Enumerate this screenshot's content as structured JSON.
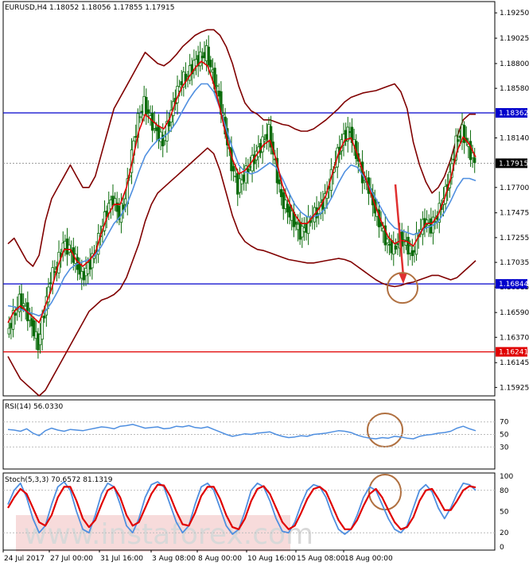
{
  "header": {
    "main": "EURUSD,H4  1.18052 1.18056 1.17855 1.17915",
    "rsi": "RSI(14) 56.0330",
    "stoch": "Stoch(5,3,3) 70.6572 81.1319"
  },
  "watermark": {
    "text": "www.instaforex.com"
  },
  "colors": {
    "candles": "#0a6b0a",
    "bollinger": "#800000",
    "ma_fast": "#e00000",
    "ma_slow": "#4f8fe0",
    "resistance": "#0000cc",
    "support_low": "#e00000",
    "arrow": "#e03030",
    "circle": "#b07040",
    "rsi_line": "#4f8fe0",
    "stoch_k": "#4f8fe0",
    "stoch_d": "#e00000"
  },
  "chart_data": [
    {
      "type": "candlestick",
      "symbol": "EURUSD",
      "timeframe": "H4",
      "ohlc_last": {
        "open": 1.18052,
        "high": 1.18056,
        "low": 1.17855,
        "close": 1.17915
      },
      "ylim": [
        1.1585,
        1.1935
      ],
      "y_ticks": [
        "1.19250",
        "1.19025",
        "1.18800",
        "1.18580",
        "1.18140",
        "1.17700",
        "1.17475",
        "1.17255",
        "1.17035",
        "1.16815",
        "1.16590",
        "1.16370",
        "1.16145",
        "1.15925"
      ],
      "x_ticks": [
        "24 Jul 2017",
        "27 Jul 00:00",
        "31 Jul 16:00",
        "3 Aug 08:00",
        "8 Aug 00:00",
        "10 Aug 16:00",
        "15 Aug 08:00",
        "18 Aug 00:00"
      ],
      "price_labels": [
        {
          "value": 1.18362,
          "label": "1.18362",
          "color": "#0000cc"
        },
        {
          "value": 1.17915,
          "label": "1.17915",
          "color": "#000000"
        },
        {
          "value": 1.16844,
          "label": "1.16844",
          "color": "#0000cc"
        },
        {
          "value": 1.16241,
          "label": "1.16241",
          "color": "#e00000"
        }
      ],
      "horizontal_lines": [
        {
          "value": 1.18362,
          "color": "#0000cc"
        },
        {
          "value": 1.16844,
          "color": "#0000cc"
        },
        {
          "value": 1.16241,
          "color": "#e00000"
        }
      ],
      "close_path": [
        1.164,
        1.1655,
        1.167,
        1.1662,
        1.1648,
        1.163,
        1.166,
        1.169,
        1.17,
        1.172,
        1.1715,
        1.1705,
        1.169,
        1.17,
        1.171,
        1.173,
        1.175,
        1.176,
        1.1745,
        1.176,
        1.18,
        1.183,
        1.1845,
        1.183,
        1.182,
        1.181,
        1.183,
        1.185,
        1.1865,
        1.187,
        1.188,
        1.1885,
        1.189,
        1.187,
        1.185,
        1.182,
        1.179,
        1.177,
        1.178,
        1.179,
        1.18,
        1.181,
        1.182,
        1.179,
        1.176,
        1.175,
        1.174,
        1.173,
        1.1735,
        1.1745,
        1.175,
        1.176,
        1.178,
        1.18,
        1.1815,
        1.182,
        1.18,
        1.178,
        1.177,
        1.175,
        1.1735,
        1.172,
        1.1715,
        1.1725,
        1.172,
        1.171,
        1.173,
        1.174,
        1.1735,
        1.1745,
        1.176,
        1.178,
        1.181,
        1.182,
        1.1805,
        1.1792
      ],
      "ma_fast": [
        1.165,
        1.166,
        1.1665,
        1.166,
        1.1655,
        1.165,
        1.1665,
        1.168,
        1.17,
        1.1715,
        1.1715,
        1.1705,
        1.17,
        1.1705,
        1.1712,
        1.173,
        1.1745,
        1.1755,
        1.1755,
        1.177,
        1.1795,
        1.182,
        1.1835,
        1.183,
        1.1825,
        1.1822,
        1.1832,
        1.1848,
        1.186,
        1.1868,
        1.1876,
        1.1882,
        1.1878,
        1.1862,
        1.184,
        1.1815,
        1.1795,
        1.1782,
        1.1785,
        1.1792,
        1.18,
        1.1808,
        1.1812,
        1.1795,
        1.1772,
        1.1758,
        1.1746,
        1.1738,
        1.1738,
        1.1745,
        1.1752,
        1.1763,
        1.1782,
        1.18,
        1.1812,
        1.1814,
        1.18,
        1.1783,
        1.1768,
        1.1752,
        1.1738,
        1.1726,
        1.172,
        1.1723,
        1.1722,
        1.1718,
        1.1728,
        1.1738,
        1.1738,
        1.1746,
        1.176,
        1.1778,
        1.1802,
        1.1815,
        1.1808,
        1.1797
      ],
      "ma_slow": [
        1.1665,
        1.1664,
        1.1662,
        1.166,
        1.1658,
        1.1656,
        1.166,
        1.1668,
        1.1678,
        1.169,
        1.1698,
        1.1702,
        1.1704,
        1.1706,
        1.171,
        1.1718,
        1.1728,
        1.1738,
        1.1744,
        1.1754,
        1.1768,
        1.1784,
        1.1798,
        1.1806,
        1.1812,
        1.1815,
        1.182,
        1.1828,
        1.1838,
        1.1848,
        1.1856,
        1.1862,
        1.1862,
        1.1855,
        1.184,
        1.1822,
        1.1805,
        1.179,
        1.1784,
        1.1782,
        1.1784,
        1.1788,
        1.1792,
        1.1788,
        1.1778,
        1.1766,
        1.1755,
        1.1748,
        1.1744,
        1.1744,
        1.1746,
        1.1752,
        1.1762,
        1.1774,
        1.1784,
        1.179,
        1.1788,
        1.178,
        1.177,
        1.176,
        1.175,
        1.174,
        1.1734,
        1.1732,
        1.173,
        1.1728,
        1.173,
        1.1734,
        1.1736,
        1.174,
        1.1748,
        1.1758,
        1.177,
        1.1778,
        1.1778,
        1.1776
      ],
      "bb_upper": [
        1.172,
        1.1725,
        1.1715,
        1.1705,
        1.17,
        1.171,
        1.174,
        1.176,
        1.177,
        1.178,
        1.179,
        1.178,
        1.177,
        1.177,
        1.178,
        1.18,
        1.182,
        1.184,
        1.185,
        1.186,
        1.187,
        1.188,
        1.189,
        1.1885,
        1.188,
        1.1878,
        1.1882,
        1.1888,
        1.1895,
        1.19,
        1.1905,
        1.1908,
        1.191,
        1.191,
        1.1905,
        1.1895,
        1.188,
        1.186,
        1.1845,
        1.1838,
        1.1835,
        1.183,
        1.183,
        1.1828,
        1.1826,
        1.1825,
        1.1822,
        1.182,
        1.182,
        1.1822,
        1.1826,
        1.183,
        1.1835,
        1.184,
        1.1846,
        1.185,
        1.1852,
        1.1854,
        1.1855,
        1.1856,
        1.1858,
        1.186,
        1.1862,
        1.1855,
        1.184,
        1.181,
        1.179,
        1.1775,
        1.1765,
        1.177,
        1.178,
        1.1795,
        1.1815,
        1.183,
        1.1835,
        1.1835
      ],
      "bb_lower": [
        1.162,
        1.161,
        1.16,
        1.1595,
        1.159,
        1.1585,
        1.159,
        1.16,
        1.161,
        1.162,
        1.163,
        1.164,
        1.165,
        1.166,
        1.1665,
        1.167,
        1.1672,
        1.1675,
        1.168,
        1.169,
        1.1705,
        1.172,
        1.174,
        1.1755,
        1.1765,
        1.177,
        1.1775,
        1.178,
        1.1785,
        1.179,
        1.1795,
        1.18,
        1.1805,
        1.18,
        1.1785,
        1.1765,
        1.1745,
        1.173,
        1.1722,
        1.1718,
        1.1715,
        1.1714,
        1.1712,
        1.171,
        1.1708,
        1.1706,
        1.1705,
        1.1704,
        1.1703,
        1.1703,
        1.1704,
        1.1705,
        1.1706,
        1.1707,
        1.1706,
        1.1704,
        1.17,
        1.1696,
        1.1692,
        1.1688,
        1.1685,
        1.1683,
        1.1682,
        1.1683,
        1.1685,
        1.1686,
        1.1688,
        1.169,
        1.1692,
        1.1692,
        1.169,
        1.1688,
        1.169,
        1.1695,
        1.17,
        1.1705
      ]
    },
    {
      "type": "line",
      "name": "RSI(14)",
      "last_value": 56.033,
      "ylim": [
        0,
        100
      ],
      "y_ticks": [
        "70",
        "50",
        "30"
      ],
      "values": [
        58,
        57,
        55,
        59,
        52,
        48,
        56,
        60,
        57,
        55,
        58,
        57,
        56,
        58,
        60,
        62,
        61,
        59,
        63,
        64,
        66,
        63,
        60,
        61,
        62,
        59,
        60,
        63,
        62,
        64,
        61,
        60,
        62,
        58,
        54,
        50,
        47,
        49,
        51,
        50,
        52,
        53,
        54,
        50,
        47,
        45,
        46,
        48,
        47,
        50,
        51,
        52,
        54,
        56,
        55,
        53,
        49,
        46,
        44,
        43,
        45,
        44,
        47,
        46,
        44,
        43,
        47,
        49,
        50,
        52,
        53,
        55,
        60,
        63,
        59,
        56
      ]
    },
    {
      "type": "line",
      "name": "Stoch(5,3,3)",
      "main": 70.6572,
      "signal": 81.1319,
      "ylim": [
        0,
        100
      ],
      "y_ticks": [
        "100",
        "80",
        "50",
        "20",
        "0"
      ],
      "k_values": [
        60,
        80,
        90,
        70,
        40,
        20,
        30,
        60,
        85,
        92,
        80,
        50,
        25,
        20,
        45,
        75,
        90,
        85,
        60,
        30,
        20,
        40,
        70,
        88,
        92,
        85,
        60,
        35,
        20,
        30,
        60,
        85,
        90,
        80,
        55,
        30,
        18,
        25,
        50,
        80,
        90,
        85,
        65,
        40,
        22,
        20,
        35,
        60,
        80,
        88,
        85,
        70,
        45,
        25,
        18,
        25,
        45,
        70,
        85,
        80,
        60,
        40,
        25,
        20,
        30,
        55,
        80,
        88,
        78,
        55,
        40,
        55,
        75,
        90,
        88,
        80
      ],
      "d_values": [
        55,
        70,
        82,
        75,
        55,
        35,
        30,
        45,
        70,
        85,
        85,
        65,
        40,
        28,
        38,
        60,
        80,
        85,
        70,
        45,
        30,
        35,
        55,
        75,
        88,
        87,
        72,
        50,
        32,
        30,
        48,
        72,
        85,
        85,
        68,
        45,
        28,
        25,
        40,
        65,
        82,
        86,
        75,
        55,
        35,
        25,
        30,
        48,
        68,
        82,
        85,
        78,
        58,
        38,
        25,
        25,
        38,
        58,
        75,
        82,
        70,
        52,
        35,
        25,
        28,
        42,
        65,
        80,
        82,
        68,
        52,
        52,
        65,
        80,
        86,
        84
      ]
    }
  ]
}
